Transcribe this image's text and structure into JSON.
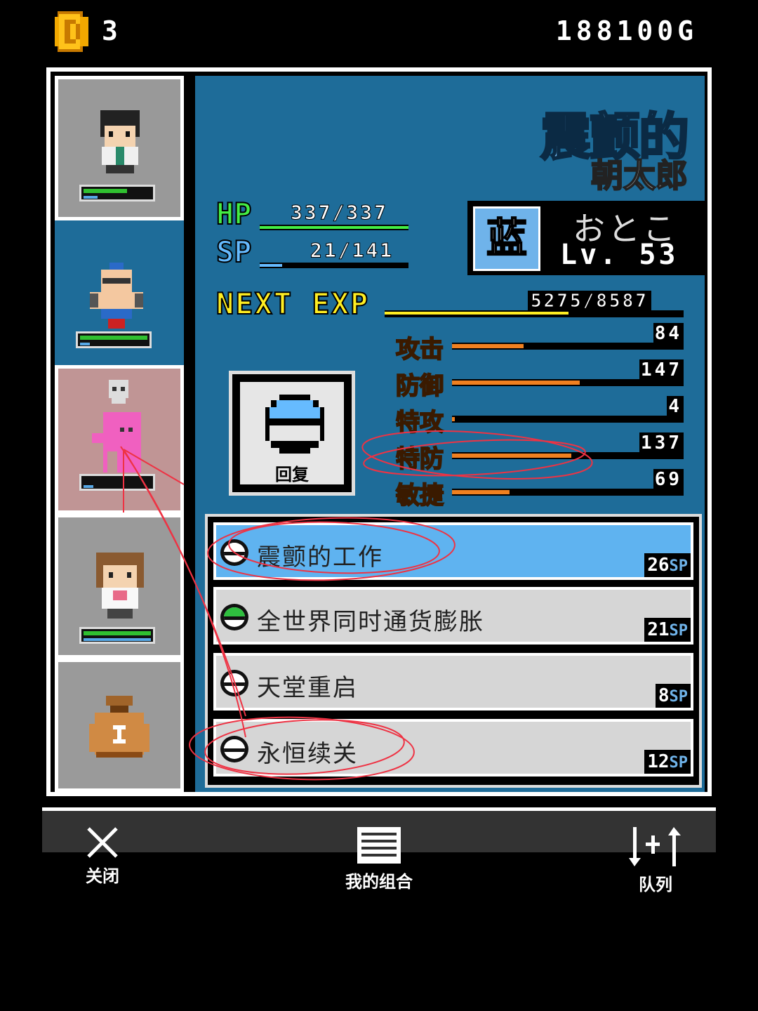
{
  "header": {
    "coin_count": "3",
    "gold": "188100G"
  },
  "character": {
    "title": "震颤的",
    "name": "朝太郎",
    "hp_label": "HP",
    "hp_value": "337/337",
    "hp_fraction": 1.0,
    "sp_label": "SP",
    "sp_value": "21/141",
    "sp_fraction": 0.149,
    "type_badge": "蓝",
    "gender": "おとこ",
    "level": "Lv. 53",
    "exp_label": "NEXT EXP",
    "exp_value": "5275/8587",
    "exp_fraction": 0.614
  },
  "stats": [
    {
      "label": "攻击",
      "value": "84",
      "fraction": 0.31
    },
    {
      "label": "防御",
      "value": "147",
      "fraction": 0.56
    },
    {
      "label": "特攻",
      "value": "4",
      "fraction": 0.01
    },
    {
      "label": "特防",
      "value": "137",
      "fraction": 0.52
    },
    {
      "label": "敏捷",
      "value": "69",
      "fraction": 0.25
    }
  ],
  "heal_button": {
    "label": "回复"
  },
  "skills": [
    {
      "name": "震颤的工作",
      "cost": "26",
      "unit": "SP",
      "icon_color": "#ffffff",
      "selected": true
    },
    {
      "name": "全世界同时通货膨胀",
      "cost": "21",
      "unit": "SP",
      "icon_color": "#2fbf3f",
      "selected": false
    },
    {
      "name": "天堂重启",
      "cost": "8",
      "unit": "SP",
      "icon_color": "#ffffff",
      "selected": false
    },
    {
      "name": "永恒续关",
      "cost": "12",
      "unit": "SP",
      "icon_color": "#ffffff",
      "selected": false
    }
  ],
  "toolbar": {
    "close_label": "关闭",
    "combo_label": "我的组合",
    "queue_label": "队列"
  },
  "colors": {
    "panel_blue": "#1e6c99",
    "hp_green": "#44ee44",
    "sp_blue": "#66bbff",
    "exp_yellow": "#ffee22",
    "stat_orange": "#f08020"
  }
}
